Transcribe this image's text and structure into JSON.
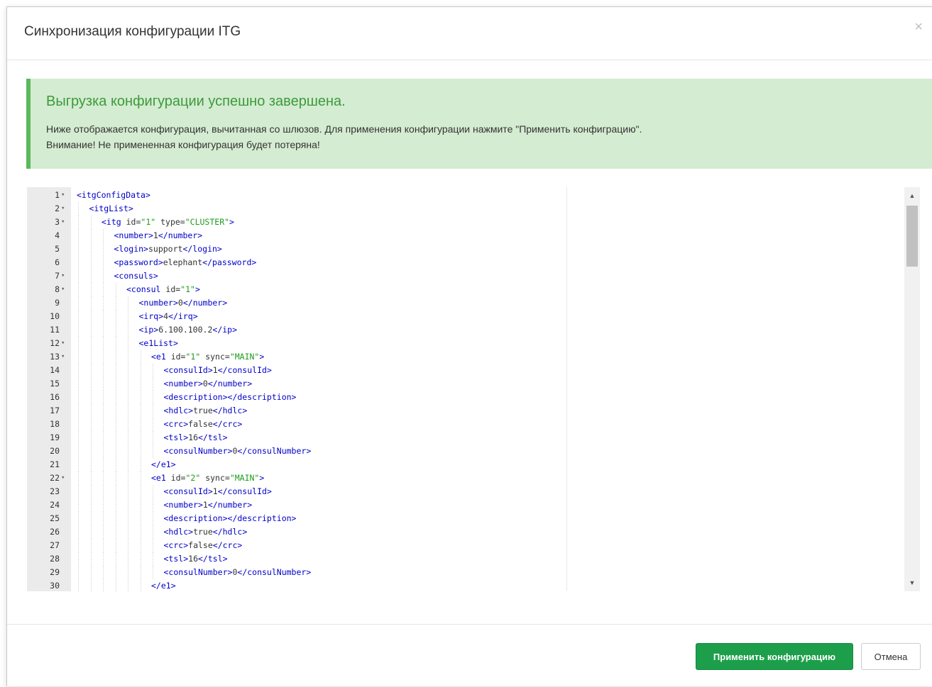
{
  "dialog": {
    "title": "Синхронизация конфигурации ITG",
    "close_glyph": "×"
  },
  "alert": {
    "title": "Выгрузка конфигурации успешно завершена.",
    "line1": "Ниже отображается конфигурация, вычитанная со шлюзов. Для применения конфигурации нажмите \"Применить конфиграцию\".",
    "line2": "Внимание! Не примененная конфигурация будет потеряна!"
  },
  "editor": {
    "lines": [
      {
        "n": "1",
        "fold": true,
        "indent": 0,
        "text": "<itgConfigData>"
      },
      {
        "n": "2",
        "fold": true,
        "indent": 1,
        "text": "<itgList>"
      },
      {
        "n": "3",
        "fold": true,
        "indent": 2,
        "text": "<itg id=\"1\" type=\"CLUSTER\">"
      },
      {
        "n": "4",
        "fold": false,
        "indent": 3,
        "text": "<number>1</number>"
      },
      {
        "n": "5",
        "fold": false,
        "indent": 3,
        "text": "<login>support</login>"
      },
      {
        "n": "6",
        "fold": false,
        "indent": 3,
        "text": "<password>elephant</password>"
      },
      {
        "n": "7",
        "fold": true,
        "indent": 3,
        "text": "<consuls>"
      },
      {
        "n": "8",
        "fold": true,
        "indent": 4,
        "text": "<consul id=\"1\">"
      },
      {
        "n": "9",
        "fold": false,
        "indent": 5,
        "text": "<number>0</number>"
      },
      {
        "n": "10",
        "fold": false,
        "indent": 5,
        "text": "<irq>4</irq>"
      },
      {
        "n": "11",
        "fold": false,
        "indent": 5,
        "text": "<ip>6.100.100.2</ip>"
      },
      {
        "n": "12",
        "fold": true,
        "indent": 5,
        "text": "<e1List>"
      },
      {
        "n": "13",
        "fold": true,
        "indent": 6,
        "text": "<e1 id=\"1\" sync=\"MAIN\">"
      },
      {
        "n": "14",
        "fold": false,
        "indent": 7,
        "text": "<consulId>1</consulId>"
      },
      {
        "n": "15",
        "fold": false,
        "indent": 7,
        "text": "<number>0</number>"
      },
      {
        "n": "16",
        "fold": false,
        "indent": 7,
        "text": "<description></description>"
      },
      {
        "n": "17",
        "fold": false,
        "indent": 7,
        "text": "<hdlc>true</hdlc>"
      },
      {
        "n": "18",
        "fold": false,
        "indent": 7,
        "text": "<crc>false</crc>"
      },
      {
        "n": "19",
        "fold": false,
        "indent": 7,
        "text": "<tsl>16</tsl>"
      },
      {
        "n": "20",
        "fold": false,
        "indent": 7,
        "text": "<consulNumber>0</consulNumber>"
      },
      {
        "n": "21",
        "fold": false,
        "indent": 6,
        "text": "</e1>"
      },
      {
        "n": "22",
        "fold": true,
        "indent": 6,
        "text": "<e1 id=\"2\" sync=\"MAIN\">"
      },
      {
        "n": "23",
        "fold": false,
        "indent": 7,
        "text": "<consulId>1</consulId>"
      },
      {
        "n": "24",
        "fold": false,
        "indent": 7,
        "text": "<number>1</number>"
      },
      {
        "n": "25",
        "fold": false,
        "indent": 7,
        "text": "<description></description>"
      },
      {
        "n": "26",
        "fold": false,
        "indent": 7,
        "text": "<hdlc>true</hdlc>"
      },
      {
        "n": "27",
        "fold": false,
        "indent": 7,
        "text": "<crc>false</crc>"
      },
      {
        "n": "28",
        "fold": false,
        "indent": 7,
        "text": "<tsl>16</tsl>"
      },
      {
        "n": "29",
        "fold": false,
        "indent": 7,
        "text": "<consulNumber>0</consulNumber>"
      },
      {
        "n": "30",
        "fold": false,
        "indent": 6,
        "text": "</e1>"
      }
    ],
    "fold_glyph": "▾",
    "scroll_up_glyph": "▲",
    "scroll_down_glyph": "▼"
  },
  "footer": {
    "apply_label": "Применить конфигурацию",
    "cancel_label": "Отмена"
  },
  "colors": {
    "tag": "#0000c8",
    "attr_value": "#1e9c1e",
    "alert_bg": "#d4ecd1",
    "alert_border": "#5cb85c",
    "alert_title": "#3c9a3c",
    "apply_button": "#1d9e4b"
  }
}
